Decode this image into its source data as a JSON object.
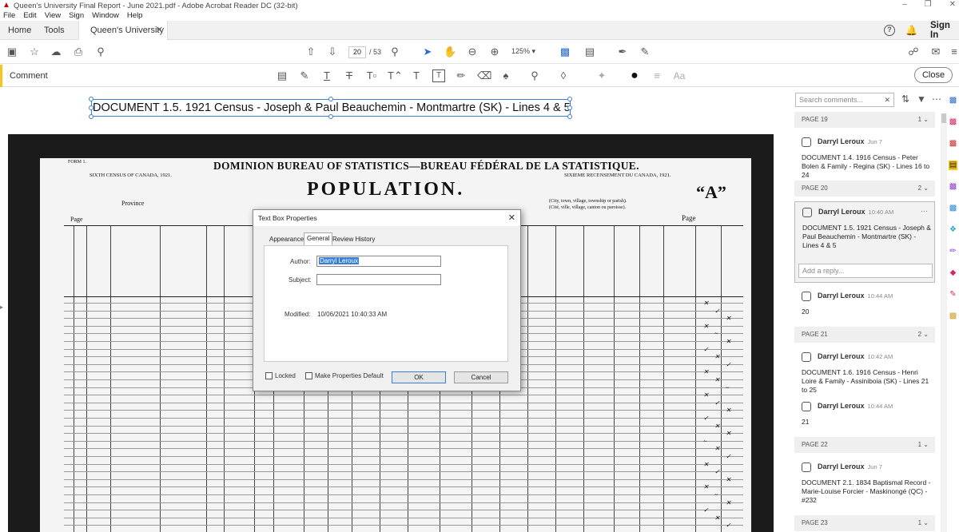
{
  "window": {
    "title": "Queen's University Final Report - June 2021.pdf - Adobe Acrobat Reader DC (32-bit)"
  },
  "menu": [
    "File",
    "Edit",
    "View",
    "Sign",
    "Window",
    "Help"
  ],
  "tabs": {
    "home": "Home",
    "tools": "Tools",
    "document": "Queen's University ..."
  },
  "header": {
    "sign_in": "Sign In"
  },
  "toolbar": {
    "page_current": "20",
    "page_total": "/ 53",
    "zoom": "125%"
  },
  "comment_bar": {
    "label": "Comment",
    "close": "Close"
  },
  "annotation": {
    "text": "DOCUMENT 1.5. 1921 Census - Joseph & Paul Beauchemin - Montmartre (SK) - Lines 4 & 5"
  },
  "document": {
    "form": "FORM 1.",
    "heading": "DOMINION BUREAU OF STATISTICS—BUREAU FÉDÉRAL DE LA STATISTIQUE.",
    "census_en": "SIXTH CENSUS OF CANADA, 1921.",
    "census_fr": "SIXIEME RECENSEMENT DU CANADA, 1921.",
    "population": "POPULATION.",
    "schedule": "“A”",
    "province": "Province",
    "city_line1": "(City, town, village, township or parish).",
    "city_line2": "(Cité, ville, village, canton ou paroisse).",
    "page_left": "Page",
    "page_right": "Page"
  },
  "dialog": {
    "title": "Text Box Properties",
    "tabs": [
      "Appearance",
      "General",
      "Review History"
    ],
    "author_label": "Author:",
    "author_value": "Darryl Leroux",
    "subject_label": "Subject:",
    "subject_value": "",
    "modified_label": "Modified:",
    "modified_value": "10/06/2021 10:40:33 AM",
    "locked": "Locked",
    "make_default": "Make Properties Default",
    "ok": "OK",
    "cancel": "Cancel"
  },
  "comments_panel": {
    "search_placeholder": "Search comments...",
    "pages": [
      {
        "label": "PAGE 19",
        "count": "1"
      },
      {
        "label": "PAGE 20",
        "count": "2"
      },
      {
        "label": "PAGE 21",
        "count": "2"
      },
      {
        "label": "PAGE 22",
        "count": "1"
      },
      {
        "label": "PAGE 23",
        "count": "1"
      }
    ],
    "comments": [
      {
        "author": "Darryl Leroux",
        "date": "Jun 7",
        "text": "DOCUMENT 1.4. 1916 Census - Peter Bolen & Family - Regina (SK) - Lines 16 to 24"
      },
      {
        "author": "Darryl Leroux",
        "date": "10:40 AM",
        "text": "DOCUMENT 1.5. 1921 Census - Joseph & Paul Beauchemin - Montmartre (SK) - Lines 4 & 5"
      },
      {
        "author": "Darryl Leroux",
        "date": "10:44 AM",
        "text": "20"
      },
      {
        "author": "Darryl Leroux",
        "date": "10:42 AM",
        "text": "DOCUMENT 1.6. 1916 Census - Henri Loire & Family - Assiniboia (SK) - Lines 21 to 25"
      },
      {
        "author": "Darryl Leroux",
        "date": "10:44 AM",
        "text": "21"
      },
      {
        "author": "Darryl Leroux",
        "date": "Jun 7",
        "text": "DOCUMENT 2.1. 1834 Baptismal Record - Marie-Louise Forcier - Maskinongé (QC) - #232"
      }
    ],
    "reply_placeholder": "Add a reply...",
    "more": "···"
  },
  "colors": {
    "accent": "#f7c51e",
    "selection": "#3a7fd5"
  }
}
